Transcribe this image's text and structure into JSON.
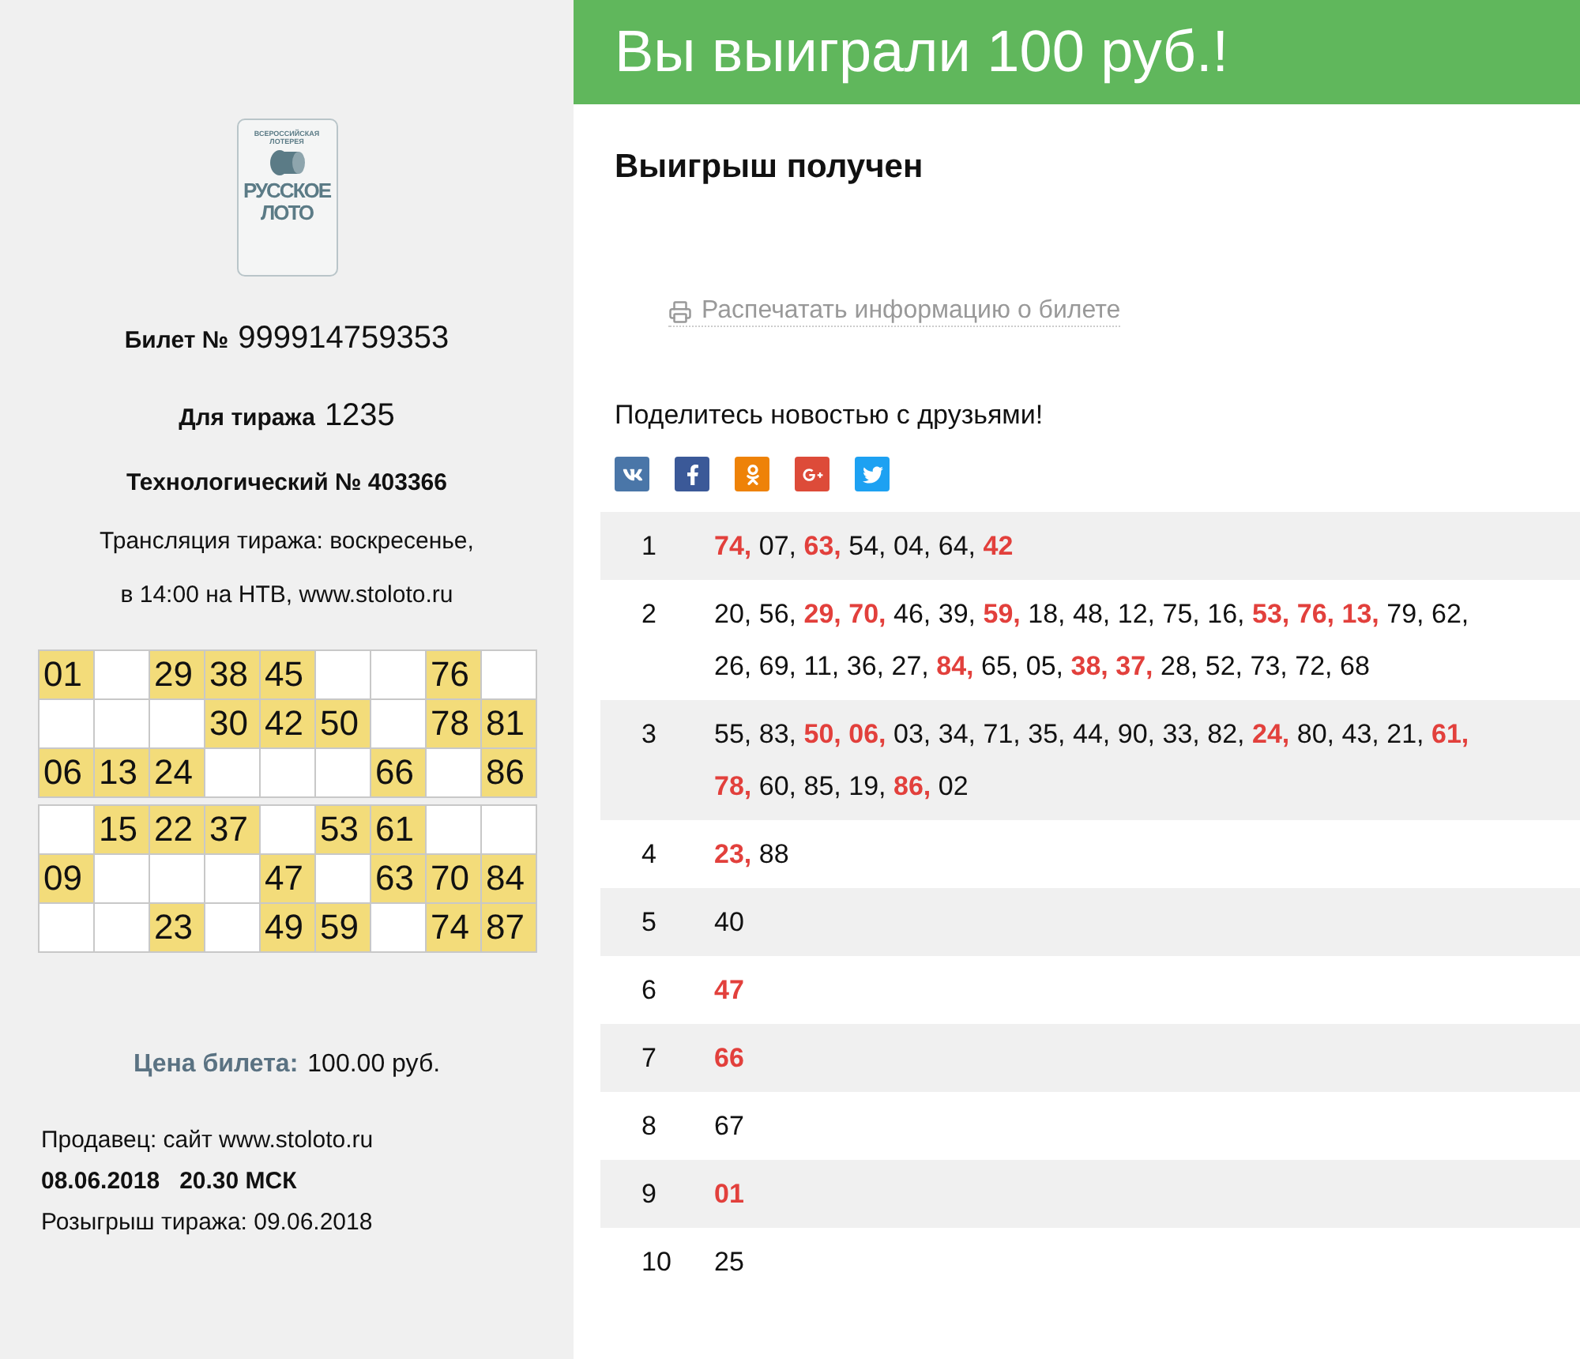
{
  "ticket": {
    "logo": {
      "top_line_1": "ВСЕРОССИЙСКАЯ",
      "top_line_2": "ЛОТЕРЕЯ",
      "name_line_1": "РУССКОЕ",
      "name_line_2": "ЛОТО"
    },
    "number": {
      "label": "Билет №",
      "value": "999914759353"
    },
    "draw": {
      "label": "Для тиража",
      "value": "1235"
    },
    "tech_number": "Технологический № 403366",
    "broadcast": [
      "Трансляция тиража: воскресенье,",
      "в 14:00 на НТВ, www.stoloto.ru"
    ],
    "cards": [
      [
        [
          {
            "kind": "number",
            "value": "01"
          },
          {
            "kind": "empty"
          },
          {
            "kind": "number",
            "value": "29"
          },
          {
            "kind": "number",
            "value": "38"
          },
          {
            "kind": "number",
            "value": "45"
          },
          {
            "kind": "empty"
          },
          {
            "kind": "empty"
          },
          {
            "kind": "number",
            "value": "76"
          },
          {
            "kind": "empty"
          }
        ],
        [
          {
            "kind": "empty"
          },
          {
            "kind": "empty"
          },
          {
            "kind": "empty"
          },
          {
            "kind": "number",
            "value": "30"
          },
          {
            "kind": "number",
            "value": "42"
          },
          {
            "kind": "number",
            "value": "50"
          },
          {
            "kind": "empty"
          },
          {
            "kind": "number",
            "value": "78"
          },
          {
            "kind": "number",
            "value": "81"
          }
        ],
        [
          {
            "kind": "number",
            "value": "06"
          },
          {
            "kind": "number",
            "value": "13"
          },
          {
            "kind": "number",
            "value": "24"
          },
          {
            "kind": "empty"
          },
          {
            "kind": "empty"
          },
          {
            "kind": "empty"
          },
          {
            "kind": "number",
            "value": "66"
          },
          {
            "kind": "empty"
          },
          {
            "kind": "number",
            "value": "86"
          }
        ]
      ],
      [
        [
          {
            "kind": "empty"
          },
          {
            "kind": "number",
            "value": "15"
          },
          {
            "kind": "number",
            "value": "22"
          },
          {
            "kind": "number",
            "value": "37"
          },
          {
            "kind": "empty"
          },
          {
            "kind": "number",
            "value": "53"
          },
          {
            "kind": "number",
            "value": "61"
          },
          {
            "kind": "empty"
          },
          {
            "kind": "empty"
          }
        ],
        [
          {
            "kind": "number",
            "value": "09"
          },
          {
            "kind": "empty"
          },
          {
            "kind": "empty"
          },
          {
            "kind": "empty"
          },
          {
            "kind": "number",
            "value": "47"
          },
          {
            "kind": "empty"
          },
          {
            "kind": "number",
            "value": "63"
          },
          {
            "kind": "number",
            "value": "70"
          },
          {
            "kind": "number",
            "value": "84"
          }
        ],
        [
          {
            "kind": "empty"
          },
          {
            "kind": "empty"
          },
          {
            "kind": "number",
            "value": "23"
          },
          {
            "kind": "empty"
          },
          {
            "kind": "number",
            "value": "49"
          },
          {
            "kind": "number",
            "value": "59"
          },
          {
            "kind": "empty"
          },
          {
            "kind": "number",
            "value": "74"
          },
          {
            "kind": "number",
            "value": "87"
          }
        ]
      ]
    ],
    "price": {
      "label": "Цена билета:",
      "value": "100.00 руб."
    },
    "seller": "Продавец: сайт www.stoloto.ru",
    "sold_at": "08.06.2018   20.30 МСК",
    "draw_date": "Розыгрыш тиража: 09.06.2018"
  },
  "result": {
    "banner": "Вы выиграли 100 руб.!",
    "status": "Выигрыш получен",
    "print_link": "Распечатать информацию о билете",
    "share_text": "Поделитесь новостью с друзьями!",
    "share_buttons": [
      {
        "kind": "vk",
        "color": "#4a76a8"
      },
      {
        "kind": "facebook",
        "color": "#3b5998"
      },
      {
        "kind": "odnoklassniki",
        "color": "#ee8208"
      },
      {
        "kind": "googleplus",
        "color": "#dd4b39"
      },
      {
        "kind": "twitter",
        "color": "#1da1f2"
      }
    ],
    "tours": [
      {
        "index": "1",
        "numbers": [
          {
            "text": "74,",
            "matched": true
          },
          {
            "text": "07,",
            "matched": false
          },
          {
            "text": "63,",
            "matched": true
          },
          {
            "text": "54,",
            "matched": false
          },
          {
            "text": "04,",
            "matched": false
          },
          {
            "text": "64,",
            "matched": false
          },
          {
            "text": "42",
            "matched": true
          }
        ]
      },
      {
        "index": "2",
        "numbers": [
          {
            "text": "20,",
            "matched": false
          },
          {
            "text": "56,",
            "matched": false
          },
          {
            "text": "29,",
            "matched": true
          },
          {
            "text": "70,",
            "matched": true
          },
          {
            "text": "46,",
            "matched": false
          },
          {
            "text": "39,",
            "matched": false
          },
          {
            "text": "59,",
            "matched": true
          },
          {
            "text": "18,",
            "matched": false
          },
          {
            "text": "48,",
            "matched": false
          },
          {
            "text": "12,",
            "matched": false
          },
          {
            "text": "75,",
            "matched": false
          },
          {
            "text": "16,",
            "matched": false
          },
          {
            "text": "53,",
            "matched": true
          },
          {
            "text": "76,",
            "matched": true
          },
          {
            "text": "13,",
            "matched": true
          },
          {
            "text": "79,",
            "matched": false
          },
          {
            "text": "62,",
            "matched": false
          },
          {
            "text": "26,",
            "matched": false
          },
          {
            "text": "69,",
            "matched": false
          },
          {
            "text": "11,",
            "matched": false
          },
          {
            "text": "36,",
            "matched": false
          },
          {
            "text": "27,",
            "matched": false
          },
          {
            "text": "84,",
            "matched": true
          },
          {
            "text": "65,",
            "matched": false
          },
          {
            "text": "05,",
            "matched": false
          },
          {
            "text": "38,",
            "matched": true
          },
          {
            "text": "37,",
            "matched": true
          },
          {
            "text": "28,",
            "matched": false
          },
          {
            "text": "52,",
            "matched": false
          },
          {
            "text": "73,",
            "matched": false
          },
          {
            "text": "72,",
            "matched": false
          },
          {
            "text": "68",
            "matched": false
          }
        ]
      },
      {
        "index": "3",
        "numbers": [
          {
            "text": "55,",
            "matched": false
          },
          {
            "text": "83,",
            "matched": false
          },
          {
            "text": "50,",
            "matched": true
          },
          {
            "text": "06,",
            "matched": true
          },
          {
            "text": "03,",
            "matched": false
          },
          {
            "text": "34,",
            "matched": false
          },
          {
            "text": "71,",
            "matched": false
          },
          {
            "text": "35,",
            "matched": false
          },
          {
            "text": "44,",
            "matched": false
          },
          {
            "text": "90,",
            "matched": false
          },
          {
            "text": "33,",
            "matched": false
          },
          {
            "text": "82,",
            "matched": false
          },
          {
            "text": "24,",
            "matched": true
          },
          {
            "text": "80,",
            "matched": false
          },
          {
            "text": "43,",
            "matched": false
          },
          {
            "text": "21,",
            "matched": false
          },
          {
            "text": "61,",
            "matched": true
          },
          {
            "text": "78,",
            "matched": true
          },
          {
            "text": "60,",
            "matched": false
          },
          {
            "text": "85,",
            "matched": false
          },
          {
            "text": "19,",
            "matched": false
          },
          {
            "text": "86,",
            "matched": true
          },
          {
            "text": "02",
            "matched": false
          }
        ]
      },
      {
        "index": "4",
        "numbers": [
          {
            "text": "23,",
            "matched": true
          },
          {
            "text": "88",
            "matched": false
          }
        ]
      },
      {
        "index": "5",
        "numbers": [
          {
            "text": "40",
            "matched": false
          }
        ]
      },
      {
        "index": "6",
        "numbers": [
          {
            "text": "47",
            "matched": true
          }
        ]
      },
      {
        "index": "7",
        "numbers": [
          {
            "text": "66",
            "matched": true
          }
        ]
      },
      {
        "index": "8",
        "numbers": [
          {
            "text": "67",
            "matched": false
          }
        ]
      },
      {
        "index": "9",
        "numbers": [
          {
            "text": "01",
            "matched": true
          }
        ]
      },
      {
        "index": "10",
        "numbers": [
          {
            "text": "25",
            "matched": false
          }
        ]
      }
    ]
  }
}
